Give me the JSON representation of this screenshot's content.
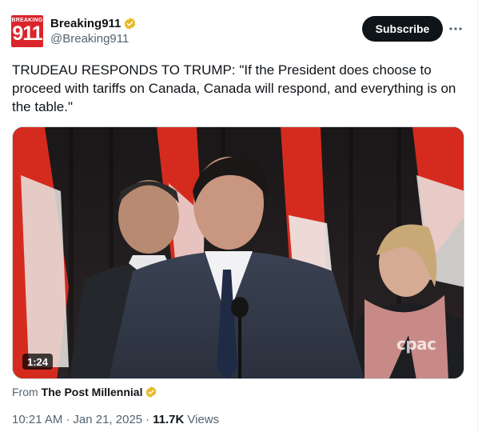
{
  "account": {
    "display_name": "Breaking911",
    "handle": "@Breaking911",
    "avatar_top_text": "BREAKING",
    "avatar_big_text": "911",
    "verified_color": "#e8b923"
  },
  "actions": {
    "subscribe_label": "Subscribe",
    "more_icon": "more-horizontal-icon"
  },
  "tweet": {
    "text": "TRUDEAU RESPONDS TO TRUMP: \"If the President does choose to proceed with tariffs on Canada, Canada will respond, and everything is on the table.\""
  },
  "media": {
    "duration": "1:24",
    "watermark": "cpac"
  },
  "source": {
    "from_label": "From",
    "name": "The Post Millennial"
  },
  "meta": {
    "time": "10:21 AM",
    "separator": "·",
    "date": "Jan 21, 2025",
    "views_count": "11.7K",
    "views_label": "Views"
  },
  "colors": {
    "accent_dark": "#0f1419",
    "secondary_text": "#536471",
    "flag_red": "#d52b1e"
  }
}
